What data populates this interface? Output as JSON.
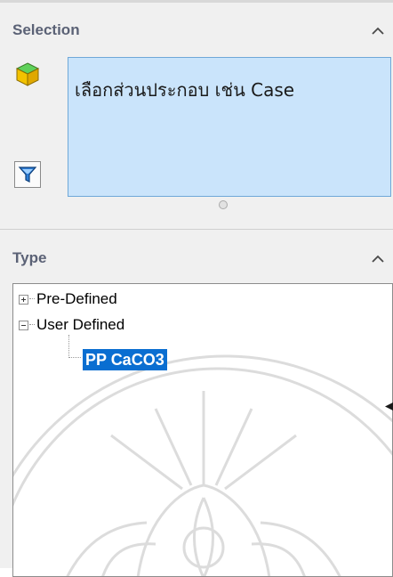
{
  "selection_section": {
    "title": "Selection",
    "box_text": "เลือกส่วนประกอบ เช่น Case",
    "part_icon": "yellow-cube-icon",
    "filter_icon": "funnel-filter-icon"
  },
  "type_section": {
    "title": "Type",
    "tree": {
      "items": [
        {
          "label": "Pre-Defined",
          "expander": "+",
          "expanded": false
        },
        {
          "label": "User Defined",
          "expander": "-",
          "expanded": true
        }
      ],
      "selected_child": {
        "label": "PP CaCO3",
        "selected": true
      }
    }
  },
  "colors": {
    "panel_bg": "#f0f0f0",
    "selection_box_bg": "#cae4fb",
    "selection_box_border": "#6fa8d8",
    "tree_selected_bg": "#0a6ed1",
    "section_title": "#5b6276"
  }
}
